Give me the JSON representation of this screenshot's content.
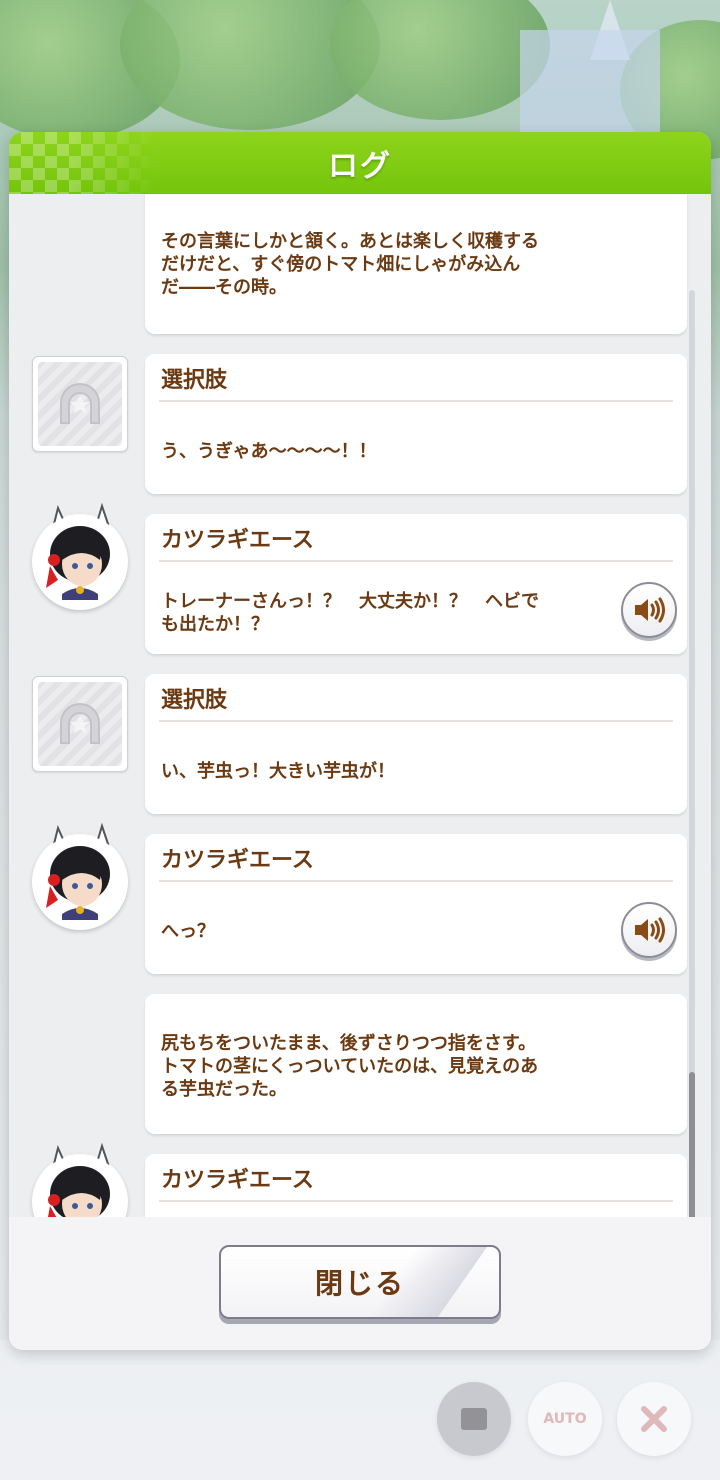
{
  "dialog": {
    "title": "ログ",
    "close_label": "閉じる"
  },
  "log": [
    {
      "type": "narration",
      "text": "その言葉にしかと頷く。あとは楽しく収穫する\nだけだと、すぐ傍のトマト畑にしゃがみ込ん\nだ――その時。"
    },
    {
      "type": "choice",
      "speaker": "選択肢",
      "text": "う、うぎゃあ〜〜〜〜！！",
      "icon": "horseshoe-star-icon"
    },
    {
      "type": "dialogue",
      "speaker": "カツラギエース",
      "text": "トレーナーさんっ！？　大丈夫か！？　ヘビで\nも出たか！？",
      "avatar": "katsuragi-ace-avatar",
      "voice": true
    },
    {
      "type": "choice",
      "speaker": "選択肢",
      "text": "い、芋虫っ！大きい芋虫が！",
      "icon": "horseshoe-star-icon"
    },
    {
      "type": "dialogue",
      "speaker": "カツラギエース",
      "text": "へっ？",
      "avatar": "katsuragi-ace-avatar",
      "voice": true
    },
    {
      "type": "narration",
      "text": "尻もちをついたまま、後ずさりつつ指をさす。\nトマトの茎にくっついていたのは、見覚えのあ\nる芋虫だった。"
    },
    {
      "type": "dialogue",
      "speaker": "カツラギエース",
      "text": "",
      "avatar": "katsuragi-ace-avatar",
      "voice": false
    }
  ],
  "hud": {
    "auto_label": "AUTO"
  },
  "colors": {
    "header_green": "#7ec814",
    "text_brown": "#6b3a12"
  }
}
